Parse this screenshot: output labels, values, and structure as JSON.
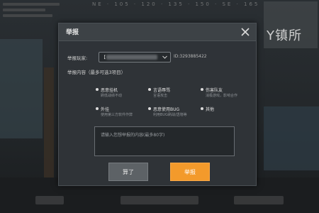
{
  "background": {
    "compass_text": "NE · 105 · 120 · 135 · 150 · SE · 165",
    "minimap_label": "Y镇所"
  },
  "dialog": {
    "title": "举报",
    "close_icon": "close-icon",
    "player_label": "举报玩家:",
    "player_name_prefix": "【",
    "player_id": "ID:3293885422",
    "content_label": "举报内容（最多可选3项目）",
    "options": [
      {
        "label": "恶意挂机",
        "desc": "刷低战绩不动"
      },
      {
        "label": "言语辱骂",
        "desc": "言语攻击"
      },
      {
        "label": "伤害队友",
        "desc": "消极游戏，影响合作"
      },
      {
        "label": "外挂",
        "desc": "使用第三方软件作弊"
      },
      {
        "label": "恶意使用BUG",
        "desc": "利用BUG刷战/透墙等"
      },
      {
        "label": "其他",
        "desc": ""
      }
    ],
    "textbox_placeholder": "请输入您想举报的内容(最多80字)",
    "cancel_label": "算了",
    "report_label": "举报"
  },
  "colors": {
    "accent": "#f39a2b",
    "dialog_bg": "#303438",
    "cancel_bg": "#5d6266"
  }
}
